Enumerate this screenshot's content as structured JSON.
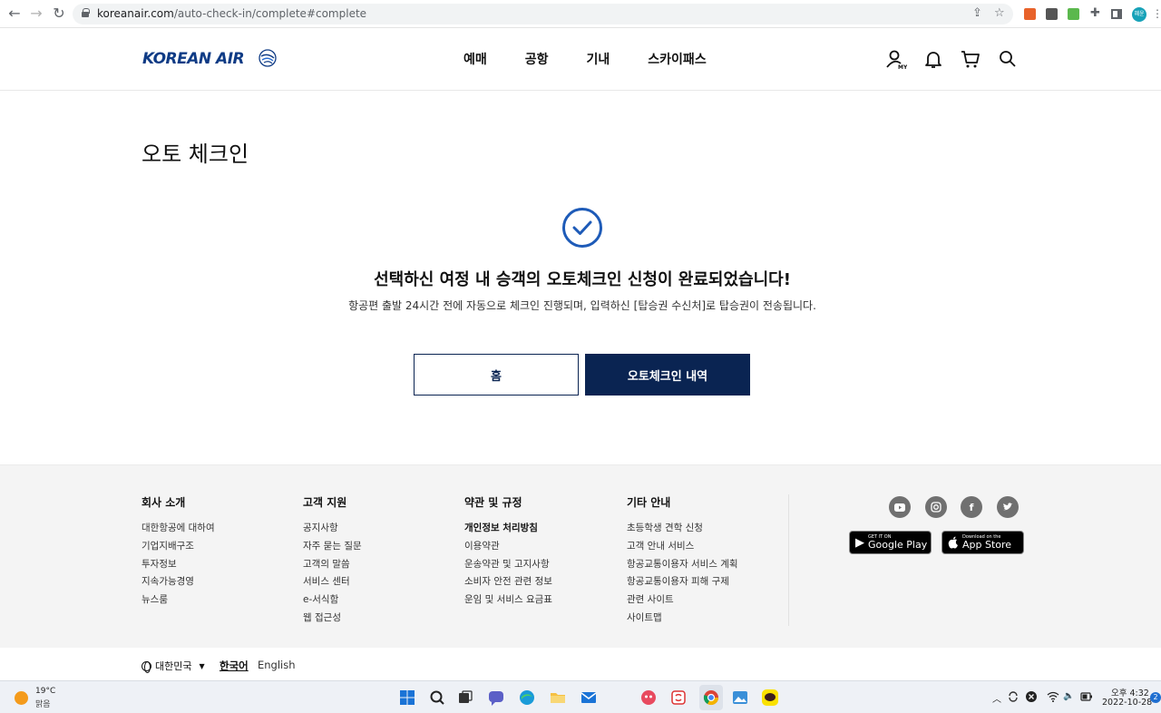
{
  "browser": {
    "url_host": "koreanair.com",
    "url_path": "/auto-check-in/complete#complete",
    "profile_initials": "혜윤"
  },
  "header": {
    "logo_text": "KOREAN AIR",
    "nav": [
      "예매",
      "공항",
      "기내",
      "스카이패스"
    ],
    "icons": [
      "my-account-icon",
      "bell-icon",
      "cart-icon",
      "search-icon"
    ],
    "my_badge": "MY"
  },
  "main": {
    "page_title": "오토 체크인",
    "headline": "선택하신 여정 내 승객의 오토체크인 신청이 완료되었습니다!",
    "subtext": "항공편 출발 24시간 전에 자동으로 체크인 진행되며, 입력하신 [탑승권 수신처]로 탑승권이 전송됩니다.",
    "btn_home": "홈",
    "btn_history": "오토체크인 내역",
    "accent_color": "#0a2452",
    "check_color": "#1e5bb8"
  },
  "footer": {
    "columns": [
      {
        "title": "회사 소개",
        "items": [
          "대한항공에 대하여",
          "기업지배구조",
          "투자정보",
          "지속가능경영",
          "뉴스룸"
        ]
      },
      {
        "title": "고객 지원",
        "items": [
          "공지사항",
          "자주 묻는 질문",
          "고객의 말씀",
          "서비스 센터",
          "e-서식함",
          "웹 접근성"
        ]
      },
      {
        "title": "약관 및 규정",
        "items": [
          "개인정보 처리방침",
          "이용약관",
          "운송약관 및 고지사항",
          "소비자 안전 관련 정보",
          "운임 및 서비스 요금표"
        ]
      },
      {
        "title": "기타 안내",
        "items": [
          "초등학생 견학 신청",
          "고객 안내 서비스",
          "항공교통이용자 서비스 계획",
          "항공교통이용자 피해 구제",
          "관련 사이트",
          "사이트맵"
        ]
      }
    ],
    "sns": [
      "youtube-icon",
      "instagram-icon",
      "facebook-icon",
      "twitter-icon"
    ],
    "google_play_small": "GET IT ON",
    "google_play_big": "Google Play",
    "app_store_small": "Download on the",
    "app_store_big": "App Store",
    "region": "대한민국",
    "lang_ko": "한국어",
    "lang_en": "English"
  },
  "taskbar": {
    "temp": "19°C",
    "weather": "맑음",
    "time": "오후 4:32",
    "date": "2022-10-28",
    "notifications": "2"
  }
}
